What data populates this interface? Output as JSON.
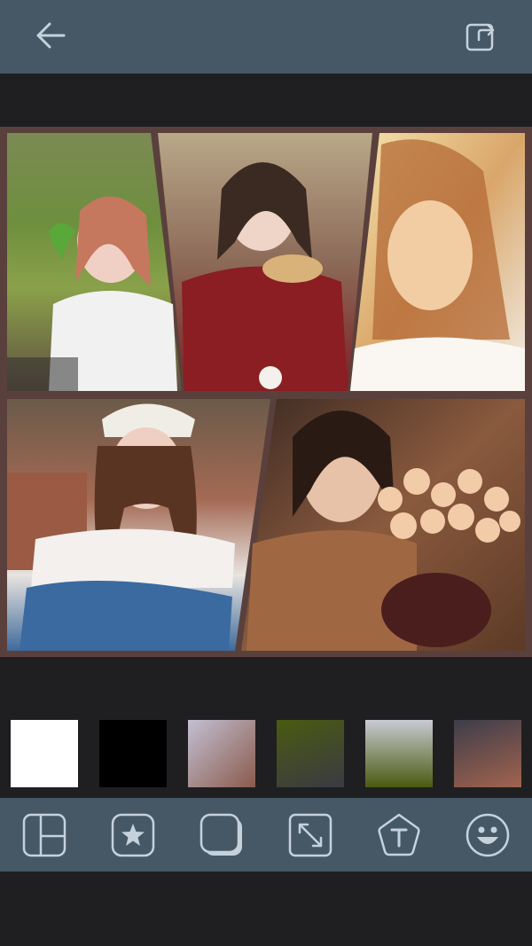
{
  "header": {
    "back_icon": "arrow-left-icon",
    "share_icon": "share-icon"
  },
  "collage": {
    "frame_color": "#5a403c",
    "photos": [
      {
        "name": "photo-girl-heart-balloon",
        "tone": "outdoor-garden"
      },
      {
        "name": "photo-girl-red-sweater-eating",
        "tone": "indoor-warm"
      },
      {
        "name": "photo-girl-sunlit-portrait",
        "tone": "golden-sunlight"
      },
      {
        "name": "photo-girl-white-cap",
        "tone": "outdoor-brick"
      },
      {
        "name": "photo-girl-rose-basket",
        "tone": "indoor-dim"
      }
    ]
  },
  "swatches": [
    {
      "name": "swatch-white",
      "colors": [
        "#ffffff",
        "#ffffff"
      ]
    },
    {
      "name": "swatch-black",
      "colors": [
        "#000000",
        "#000000"
      ]
    },
    {
      "name": "swatch-lavender-brown",
      "colors": [
        "#c3c0d2",
        "#8a5a4c"
      ]
    },
    {
      "name": "swatch-olive-dark",
      "colors": [
        "#4a5a10",
        "#3a3a44"
      ]
    },
    {
      "name": "swatch-silver-olive",
      "colors": [
        "#c9cbd2",
        "#4a5a10"
      ]
    },
    {
      "name": "swatch-slate-rust",
      "colors": [
        "#3d3d4a",
        "#a2634e"
      ]
    }
  ],
  "toolbar": {
    "tools": [
      {
        "name": "layout-icon"
      },
      {
        "name": "sticker-star-icon"
      },
      {
        "name": "border-corner-icon"
      },
      {
        "name": "resize-icon"
      },
      {
        "name": "text-tag-icon"
      },
      {
        "name": "emoji-smile-icon"
      }
    ]
  },
  "colors": {
    "bar": "#465866",
    "background": "#1f1f21",
    "icon": "#c5d2dc"
  }
}
